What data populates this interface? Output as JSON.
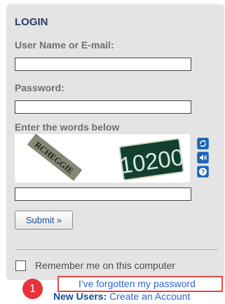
{
  "login": {
    "title": "LOGIN",
    "username_label": "User Name or E-mail:",
    "username_value": "",
    "password_label": "Password:",
    "password_value": "",
    "captcha_label": "Enter the words below",
    "captcha_word_1": "RCHEGGIE",
    "captcha_word_2": "10200",
    "captcha_value": "",
    "captcha_buttons": [
      "refresh-icon",
      "audio-icon",
      "help-icon"
    ],
    "submit_label": "Submit »",
    "remember_label": "Remember me on this computer",
    "forgot_link": "I've forgotten my password",
    "new_users_prefix": "New Users:",
    "create_account_link": "Create an Account"
  },
  "annotation": {
    "badge_number": "1",
    "highlight_color": "#e04848"
  },
  "colors": {
    "panel": "#e4e4e4",
    "title": "#2a3f63",
    "link": "#2f66c8",
    "captcha_button": "#1e63b5"
  }
}
